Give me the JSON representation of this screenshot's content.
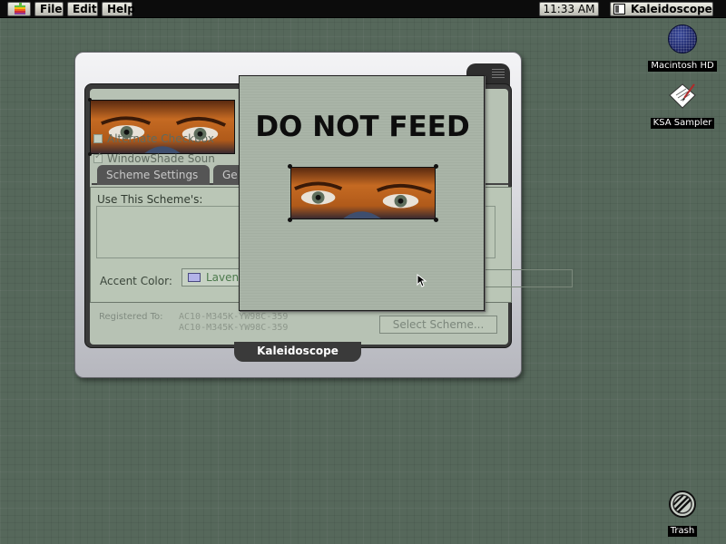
{
  "menubar": {
    "apple_icon": "apple-rainbow-icon",
    "file": "File",
    "edit": "Edit",
    "help": "Help",
    "clock": "11:33 AM",
    "app_name": "Kaleidoscope"
  },
  "desktop": {
    "icons": [
      {
        "label": "Macintosh HD",
        "icon": "hard-drive-icon"
      },
      {
        "label": "KSA Sampler",
        "icon": "document-icon"
      },
      {
        "label": "Trash",
        "icon": "trash-icon"
      }
    ]
  },
  "control_panel": {
    "title": "Kaleidoscope",
    "tabs": [
      {
        "label": "Scheme Settings"
      },
      {
        "label": "Ge"
      }
    ],
    "group_title": "Use This Scheme's:",
    "checkboxes": [
      {
        "label": "Alternate Checkbox",
        "checked": false
      },
      {
        "label": "WindowShade Soun",
        "checked": true
      }
    ],
    "accent_label": "Accent Color:",
    "accent_value": "Laven",
    "accent_color": "#b3b3e8",
    "registered_label": "Registered To:",
    "registered_code_1": "AC10-M345K-YW98C-359",
    "registered_code_2": "AC10-M345K-YW98C-359",
    "select_scheme_button": "Select Scheme..."
  },
  "dnf_window": {
    "title": "DO NOT FEED"
  },
  "colors": {
    "desktop": "#56685b",
    "panel_content": "#b7c2b4",
    "window_bg": "#a9b4a7"
  }
}
